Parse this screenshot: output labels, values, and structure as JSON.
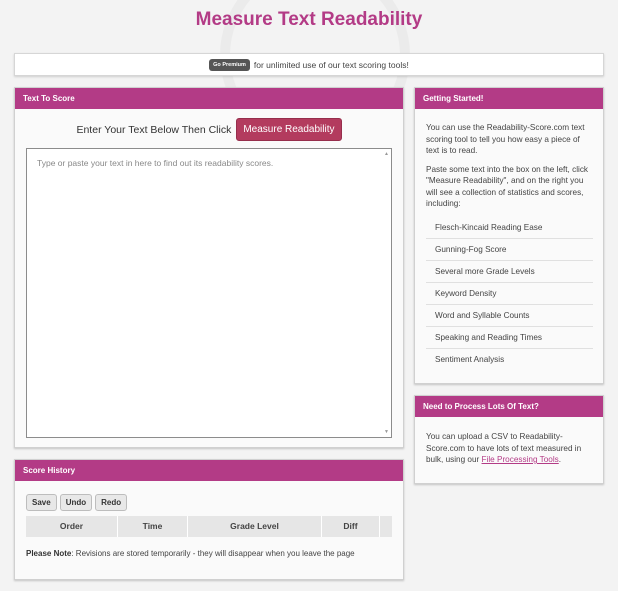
{
  "page_title": "Measure Text Readability",
  "premium": {
    "button_label": "Go Premium",
    "text": "for unlimited use of our text scoring tools!"
  },
  "score_panel": {
    "title": "Text To Score",
    "prompt": "Enter Your Text Below Then Click",
    "measure_button": "Measure Readability",
    "textarea_placeholder": "Type or paste your text in here to find out its readability scores."
  },
  "history": {
    "title": "Score History",
    "buttons": {
      "save": "Save",
      "undo": "Undo",
      "redo": "Redo"
    },
    "columns": [
      "Order",
      "Time",
      "Grade Level",
      "Diff",
      ""
    ],
    "note_label": "Please Note",
    "note_text": ": Revisions are stored temporarily - they will disappear when you leave the page"
  },
  "getting_started": {
    "title": "Getting Started!",
    "para1": "You can use the Readability-Score.com text scoring tool to tell you how easy a piece of text is to read.",
    "para2": "Paste some text into the box on the left, click \"Measure Readability\", and on the right you will see a collection of statistics and scores, including:",
    "features": [
      "Flesch-Kincaid Reading Ease",
      "Gunning-Fog Score",
      "Several more Grade Levels",
      "Keyword Density",
      "Word and Syllable Counts",
      "Speaking and Reading Times",
      "Sentiment Analysis"
    ]
  },
  "process": {
    "title": "Need to Process Lots Of Text?",
    "text_before": "You can upload a CSV to Readability-Score.com to have lots of text measured in bulk, using our ",
    "link_text": "File Processing Tools",
    "text_after": "."
  },
  "colors": {
    "brand": "#b33b86",
    "measure_button": "#b33b5e"
  }
}
